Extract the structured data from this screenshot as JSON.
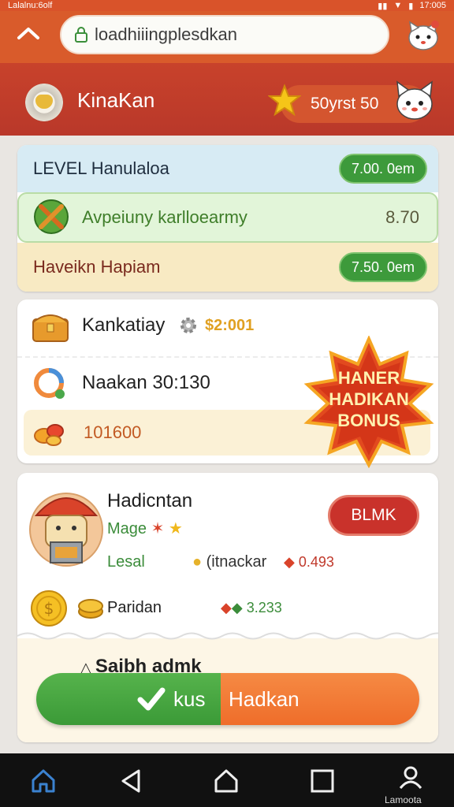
{
  "statusbar": {
    "left": "Lalalnu:6olf",
    "right": "17:005"
  },
  "browser": {
    "url": "loadhiiingplesdkan"
  },
  "header": {
    "title": "KinaKan",
    "coins": "50yrst 50"
  },
  "levels": [
    {
      "label": "LEVEL Hanulaloa",
      "value": "7.00. 0em"
    },
    {
      "label": "Avpeiuny karlloearmy",
      "value": "8.70"
    },
    {
      "label": "Haveikn Hapiam",
      "value": "7.50. 0em"
    }
  ],
  "rewards": {
    "row1": {
      "label": "Kankatiay",
      "amount": "$2:001"
    },
    "row2": {
      "label": "Naakan 30:130"
    },
    "row3": {
      "label": "101600"
    }
  },
  "bonus": {
    "line1": "HANER",
    "line2": "HADIKAN",
    "line3": "BONUS"
  },
  "profile": {
    "name": "Hadicntan",
    "mage": "Mage",
    "lesal": "Lesal",
    "detail": "(itnackar",
    "detail_value": "0.493",
    "button": "BLMK",
    "paridan": "Paridan",
    "paridan_value": "3.233",
    "sub": "Saibh admk"
  },
  "actions": {
    "left": "kus",
    "right": "Hadkan"
  },
  "nav": {
    "label": "Lamoota"
  }
}
